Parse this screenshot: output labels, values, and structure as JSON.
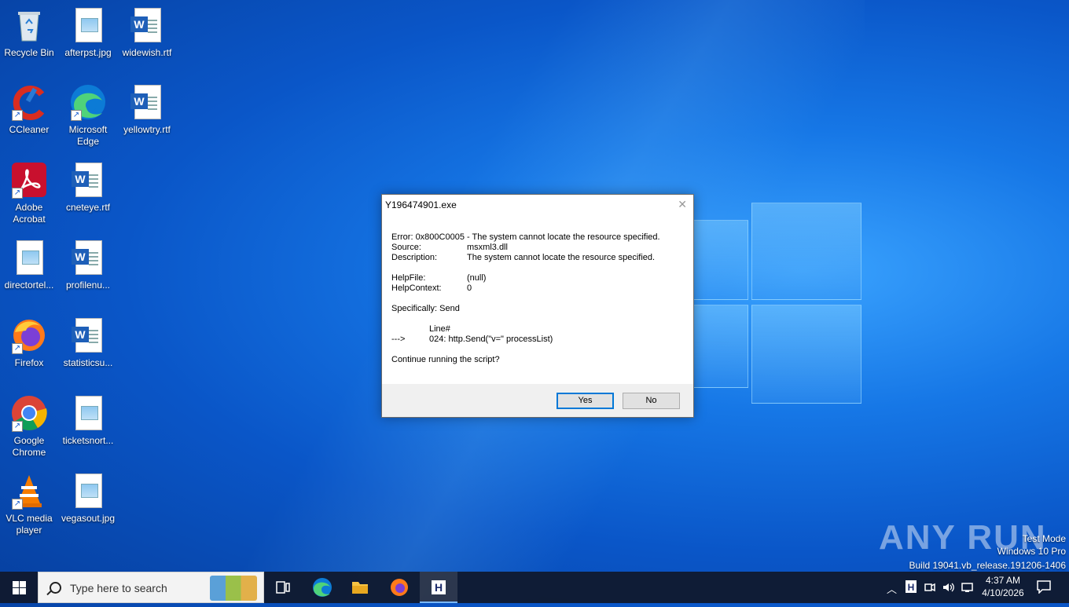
{
  "desktop_icons": [
    {
      "label": "Recycle Bin",
      "icon": "recycle-bin-icon"
    },
    {
      "label": "afterpst.jpg",
      "icon": "image-file-icon"
    },
    {
      "label": "widewish.rtf",
      "icon": "word-document-icon"
    },
    {
      "label": "CCleaner",
      "icon": "ccleaner-icon"
    },
    {
      "label": "Microsoft Edge",
      "icon": "edge-icon"
    },
    {
      "label": "yellowtry.rtf",
      "icon": "word-document-icon"
    },
    {
      "label": "Adobe Acrobat",
      "icon": "acrobat-icon"
    },
    {
      "label": "cneteye.rtf",
      "icon": "word-document-icon"
    },
    {
      "label": "directortel...",
      "icon": "image-file-icon"
    },
    {
      "label": "profilenu...",
      "icon": "word-document-icon"
    },
    {
      "label": "Firefox",
      "icon": "firefox-icon"
    },
    {
      "label": "statisticsu...",
      "icon": "word-document-icon"
    },
    {
      "label": "Google Chrome",
      "icon": "chrome-icon"
    },
    {
      "label": "ticketsnort...",
      "icon": "image-file-icon"
    },
    {
      "label": "VLC media player",
      "icon": "vlc-icon"
    },
    {
      "label": "vegasout.jpg",
      "icon": "image-file-icon"
    }
  ],
  "dialog": {
    "title": "Y196474901.exe",
    "error_label": "Error:",
    "error_value": "0x800C0005 - The system cannot locate the resource specified.",
    "source_label": "Source:",
    "source_value": "msxml3.dll",
    "description_label": "Description:",
    "description_value": "The system cannot locate the resource specified.",
    "helpfile_label": "HelpFile:",
    "helpfile_value": "(null)",
    "helpcontext_label": "HelpContext:",
    "helpcontext_value": "0",
    "specifically": "Specifically: Send",
    "line_header": "Line#",
    "arrow": "--->",
    "line_value": "024: http.Send(\"v=\" processList)",
    "question": "Continue running the script?",
    "yes_label": "Yes",
    "no_label": "No"
  },
  "watermark": {
    "brand": "ANY RUN",
    "mode": "Test Mode",
    "edition": "Windows 10 Pro",
    "build": "Build 19041.vb_release.191206-1406"
  },
  "taskbar": {
    "search_placeholder": "Type here to search",
    "time": "4:37 AM",
    "date": "4/10/2026"
  }
}
